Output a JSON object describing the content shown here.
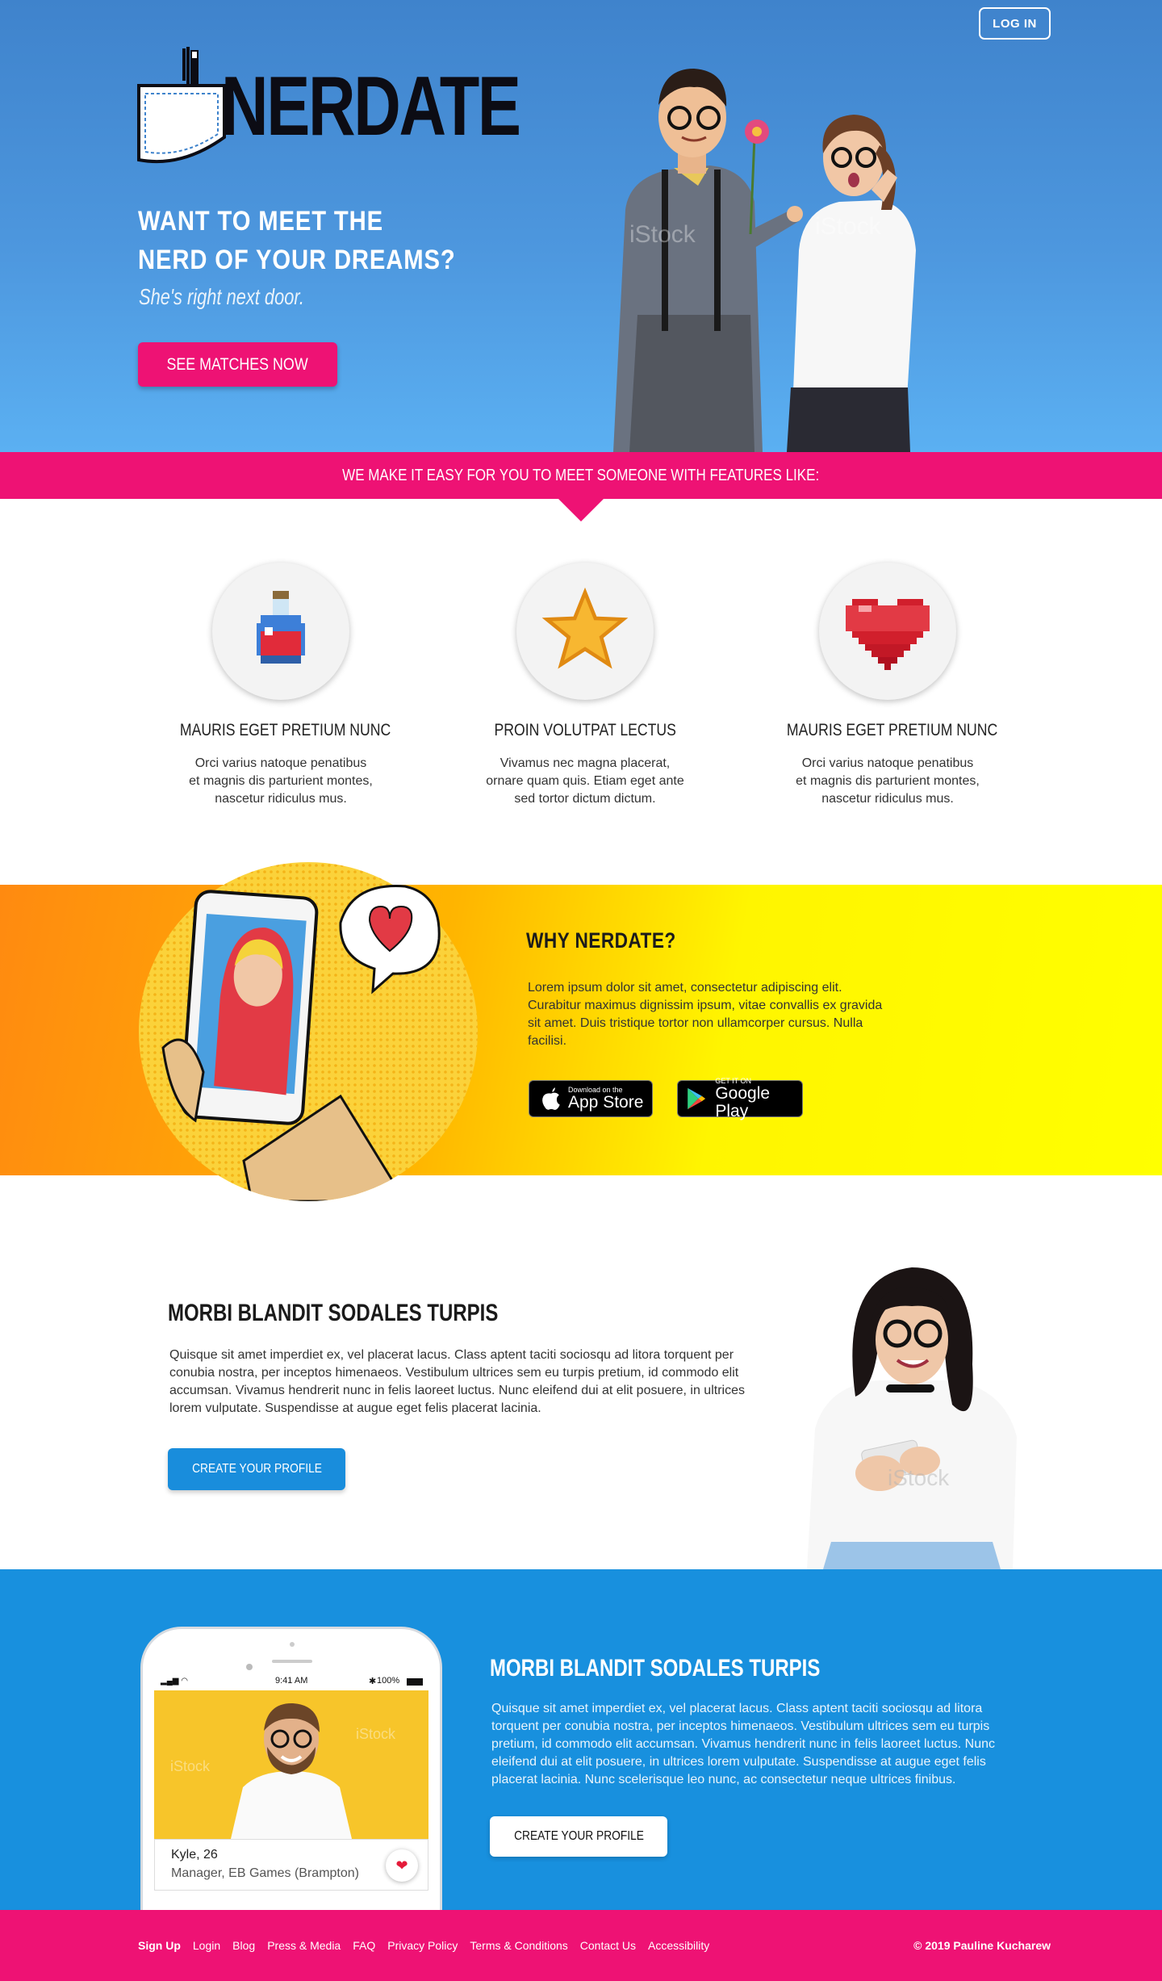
{
  "header": {
    "login_label": "LOG IN"
  },
  "brand": {
    "logo_text": "NERDATE"
  },
  "hero": {
    "title_line1": "WANT TO MEET THE",
    "title_line2": "NERD OF YOUR DREAMS?",
    "subtitle": "She's right next door.",
    "cta_label": "SEE MATCHES NOW"
  },
  "banner": {
    "text": "WE MAKE IT EASY FOR YOU TO MEET SOMEONE WITH FEATURES LIKE:"
  },
  "features": [
    {
      "icon": "potion-icon",
      "title": "MAURIS EGET PRETIUM NUNC",
      "description": "Orci varius natoque penatibus\net magnis dis parturient montes,\nnascetur ridiculus mus."
    },
    {
      "icon": "star-icon",
      "title": "PROIN VOLUTPAT LECTUS",
      "description": "Vivamus nec magna placerat,\nornare quam quis. Etiam eget ante\nsed tortor dictum dictum."
    },
    {
      "icon": "heart-icon",
      "title": "MAURIS EGET PRETIUM NUNC",
      "description": "Orci varius natoque penatibus\net magnis dis parturient montes,\nnascetur ridiculus mus."
    }
  ],
  "why": {
    "title": "WHY NERDATE?",
    "text": "Lorem ipsum dolor sit amet, consectetur adipiscing elit. Curabitur maximus dignissim ipsum, vitae convallis ex gravida sit amet. Duis tristique tortor non ullamcorper cursus. Nulla facilisi.",
    "app_store": {
      "small": "Download on the",
      "big": "App Store"
    },
    "google_play": {
      "small": "GET IT ON",
      "big": "Google Play"
    }
  },
  "section3": {
    "title": "MORBI BLANDIT SODALES TURPIS",
    "text": "Quisque sit amet imperdiet ex, vel placerat lacus. Class aptent taciti sociosqu ad litora torquent per conubia nostra, per inceptos himenaeos. Vestibulum ultrices sem eu turpis pretium, id commodo elit accumsan. Vivamus hendrerit nunc in felis laoreet luctus. Nunc eleifend dui at elit posuere, in ultrices lorem vulputate. Suspendisse at augue eget felis placerat lacinia.",
    "cta_label": "CREATE YOUR PROFILE"
  },
  "section4": {
    "title": "MORBI BLANDIT SODALES TURPIS",
    "text": "Quisque sit amet imperdiet ex, vel placerat lacus. Class aptent taciti sociosqu ad litora torquent per conubia nostra, per inceptos himenaeos. Vestibulum ultrices sem eu turpis pretium, id commodo elit accumsan. Vivamus hendrerit nunc in felis laoreet luctus. Nunc eleifend dui at elit posuere, in ultrices lorem vulputate. Suspendisse at augue eget felis placerat lacinia. Nunc scelerisque leo nunc, ac consectetur neque ultrices finibus.",
    "cta_label": "CREATE YOUR PROFILE",
    "phone": {
      "time": "9:41 AM",
      "battery": "100%",
      "profile_name": "Kyle, 26",
      "profile_role": "Manager, EB Games (Brampton)"
    }
  },
  "footer": {
    "links": [
      "Sign Up",
      "Login",
      "Blog",
      "Press & Media",
      "FAQ",
      "Privacy Policy",
      "Terms & Conditions",
      "Contact Us",
      "Accessibility"
    ],
    "copyright": "© 2019 Pauline Kucharew"
  },
  "colors": {
    "brand_pink": "#ee1274",
    "hero_blue": "#4d97de",
    "section_blue": "#1890de",
    "yellow": "#ffff00",
    "orange": "#ff8a10"
  }
}
